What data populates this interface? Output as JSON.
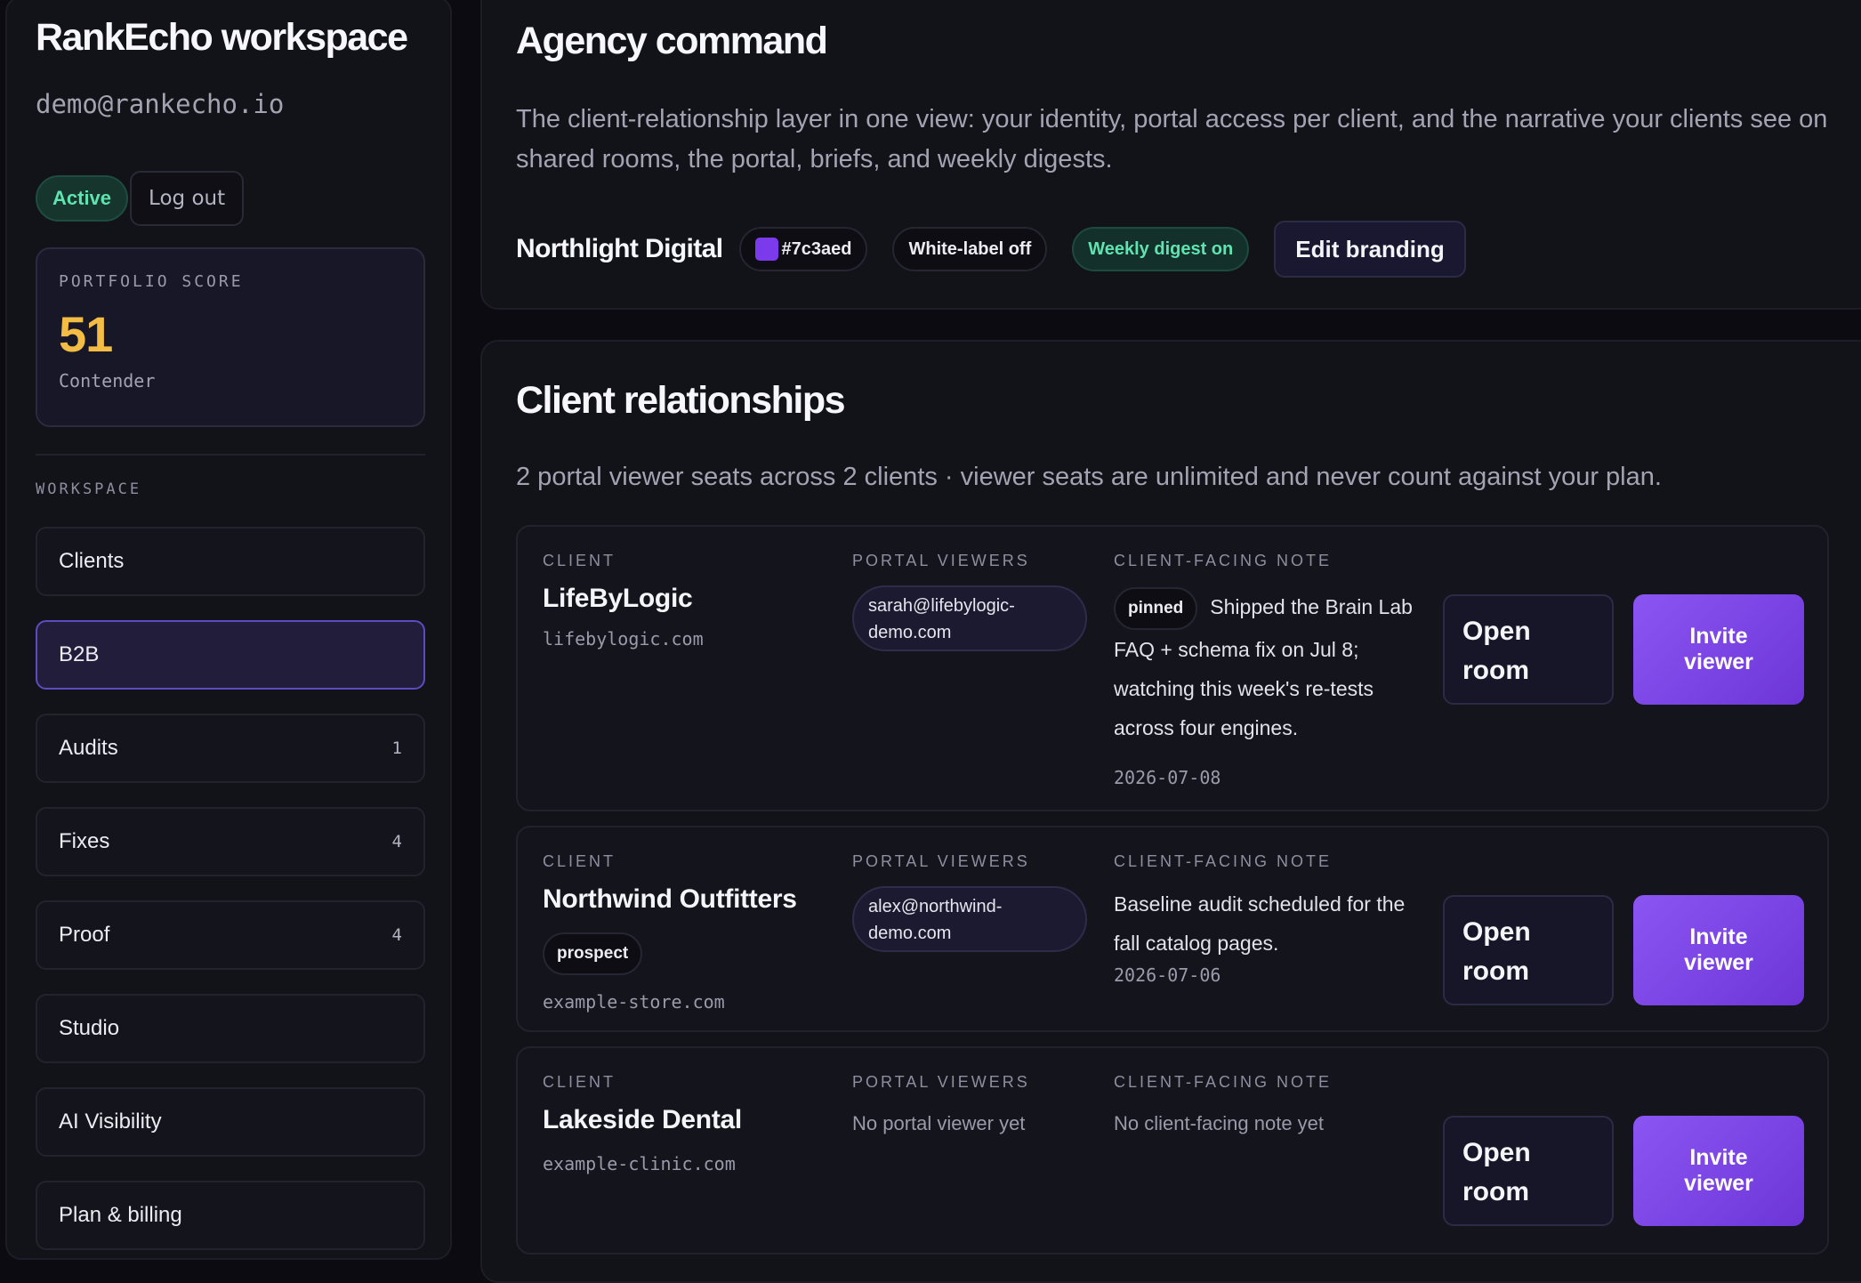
{
  "sidebar": {
    "title": "RankEcho workspace",
    "email": "demo@rankecho.io",
    "status": "Active",
    "logout_label": "Log out",
    "score": {
      "label": "PORTFOLIO SCORE",
      "value": "51",
      "tier": "Contender"
    },
    "section_label": "WORKSPACE",
    "items": [
      {
        "label": "Clients",
        "count": "",
        "active": false
      },
      {
        "label": "B2B",
        "count": "",
        "active": true
      },
      {
        "label": "Audits",
        "count": "1",
        "active": false
      },
      {
        "label": "Fixes",
        "count": "4",
        "active": false
      },
      {
        "label": "Proof",
        "count": "4",
        "active": false
      },
      {
        "label": "Studio",
        "count": "",
        "active": false
      },
      {
        "label": "AI Visibility",
        "count": "",
        "active": false
      },
      {
        "label": "Plan & billing",
        "count": "",
        "active": false
      }
    ]
  },
  "agency": {
    "title": "Agency command",
    "intro": "The client-relationship layer in one view: your identity, portal access per client, and the narrative your clients see on shared rooms, the portal, briefs, and weekly digests.",
    "name": "Northlight Digital",
    "brand_color": "#7c3aed",
    "white_label": "White-label off",
    "digest": "Weekly digest on",
    "edit_label": "Edit branding"
  },
  "relationships": {
    "title": "Client relationships",
    "subtitle": "2 portal viewer seats across 2 clients · viewer seats are unlimited and never count against your plan.",
    "col_client": "CLIENT",
    "col_viewers": "PORTAL VIEWERS",
    "col_note": "CLIENT-FACING NOTE",
    "open_label": "Open room",
    "invite_label": "Invite viewer",
    "clients": [
      {
        "name": "LifeByLogic",
        "domain": "lifebylogic.com",
        "viewer": "sarah@lifebylogic-demo.com",
        "note_tag": "pinned",
        "note": "Shipped the Brain Lab FAQ + schema fix on Jul 8; watching this week's re-tests across four engines.",
        "date": "2026-07-08"
      },
      {
        "name": "Northwind Outfitters",
        "tag": "prospect",
        "domain": "example-store.com",
        "viewer": "alex@northwind-demo.com",
        "note": "Baseline audit scheduled for the fall catalog pages.",
        "date": "2026-07-06"
      },
      {
        "name": "Lakeside Dental",
        "domain": "example-clinic.com",
        "viewer_empty": "No portal viewer yet",
        "note_empty": "No client-facing note yet"
      }
    ]
  }
}
